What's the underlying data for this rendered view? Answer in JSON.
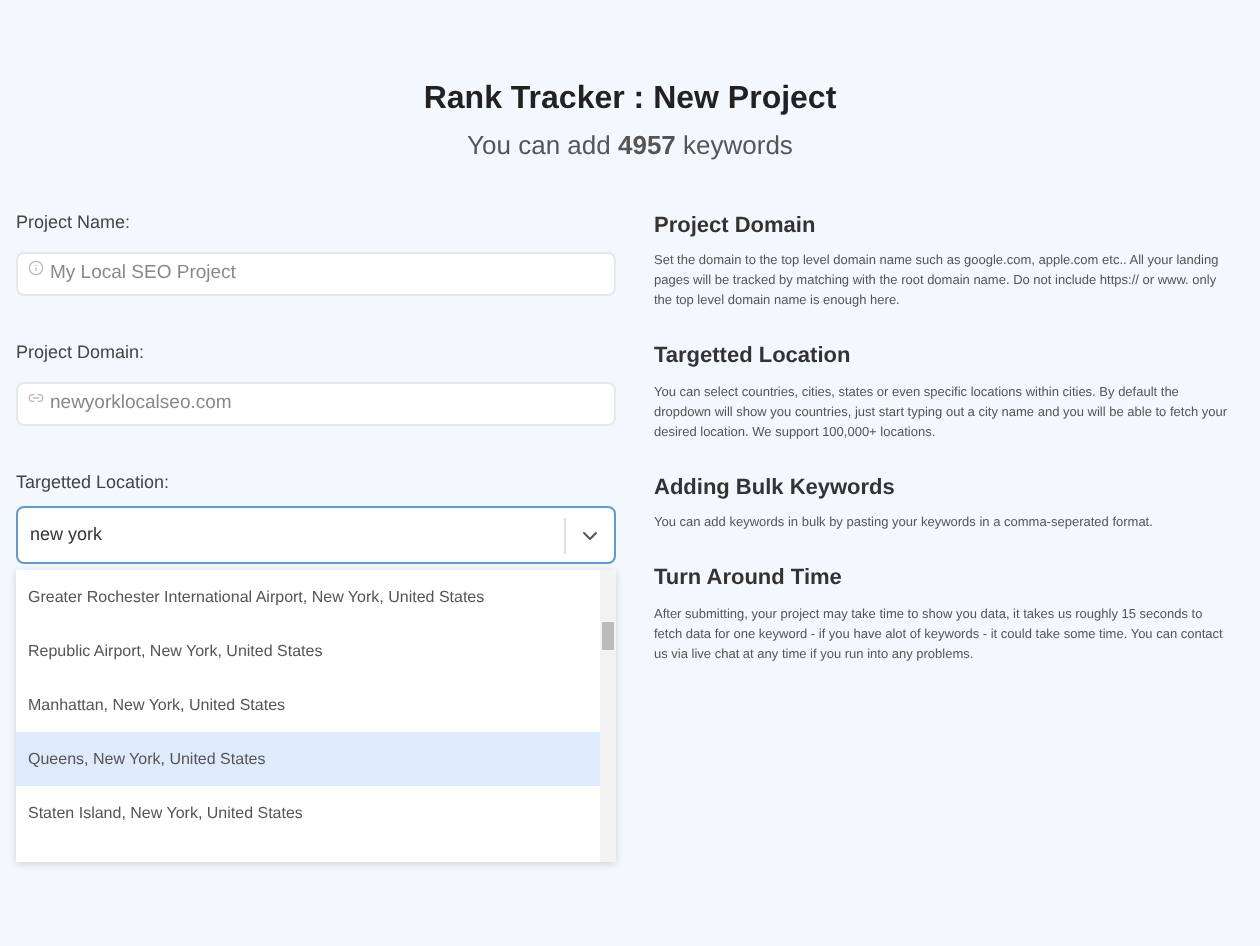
{
  "header": {
    "title": "Rank Tracker : New Project",
    "subtitle": "You can add **4957** keywords"
  },
  "form": {
    "fields": [
      {
        "kind": "text",
        "label": "Project Name:",
        "placeholder": "My Local SEO Project"
      },
      {
        "kind": "text",
        "label": "Project Domain:",
        "placeholder": "newyorklocalseo.com"
      },
      {
        "kind": "select",
        "label": "Targetted Location:",
        "value": "new york",
        "options": [
          {
            "label": "Greater Rochester International Airport, New York, United States",
            "selected": false
          },
          {
            "label": "Republic Airport, New York, United States",
            "selected": false
          },
          {
            "label": "Manhattan, New York, United States",
            "selected": false
          },
          {
            "label": "Queens, New York, United States",
            "selected": true
          },
          {
            "label": "Staten Island, New York, United States",
            "selected": false
          }
        ]
      }
    ]
  },
  "help": [
    {
      "title": "Project Domain",
      "text": "Set the domain to the top level domain name such as google.com, apple.com etc.. All your landing pages will be tracked by matching with the root domain name. Do not include https:// or www. only the top level domain name is enough here."
    },
    {
      "title": "Targetted Location",
      "text": "You can select countries, cities, states or even specific locations within cities. By default the dropdown will show you countries, just start typing out a city name and you will be able to fetch your desired location. We support 100,000+ locations."
    },
    {
      "title": "Adding Bulk Keywords",
      "text": "You can add keywords in bulk by pasting your keywords in a comma-seperated format."
    },
    {
      "title": "Turn Around Time",
      "text": "After submitting, your project may take time to show you data, it takes us roughly 15 seconds to fetch data for one keyword - if you have alot of keywords - it could take some time. You can contact us via live chat at any time if you run into any problems."
    }
  ]
}
